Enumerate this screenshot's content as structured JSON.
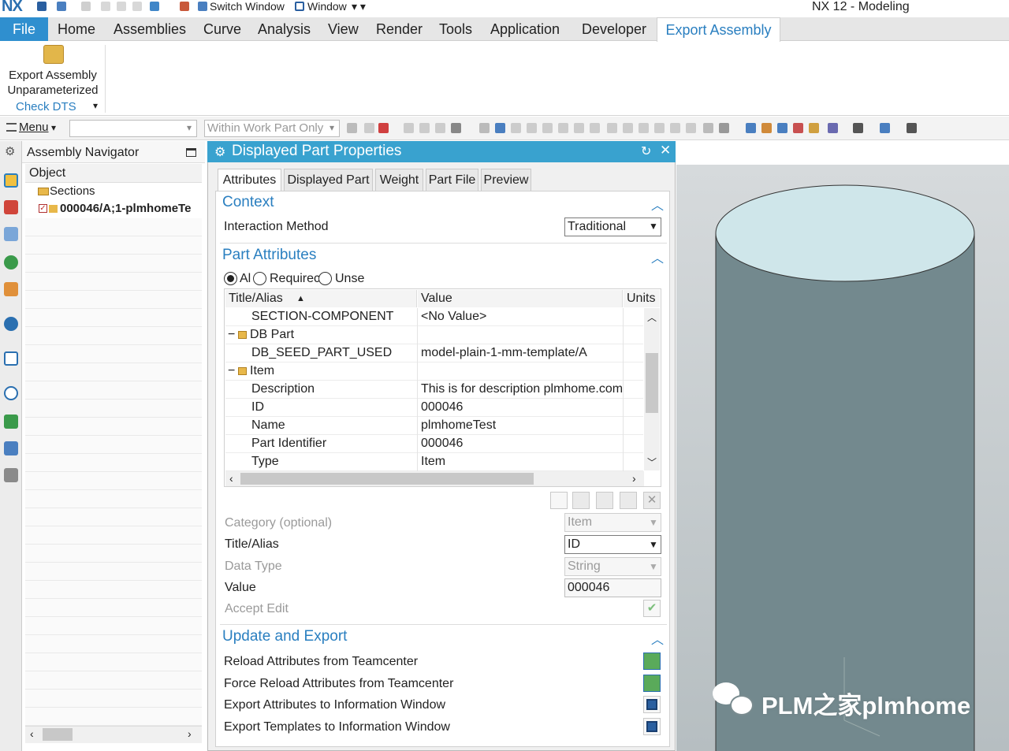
{
  "app": {
    "logo": "NX",
    "title": "NX 12 - Modeling",
    "switch_window": "Switch Window",
    "window_menu": "Window"
  },
  "ribbon": {
    "file": "File",
    "tabs": [
      "Home",
      "Assemblies",
      "Curve",
      "Analysis",
      "View",
      "Render",
      "Tools",
      "Application",
      "Developer"
    ],
    "active_tab": "Export Assembly",
    "export_btn": [
      "Export Assembly",
      "Unparameterized"
    ],
    "check_dts": "Check DTS"
  },
  "cmdbar": {
    "menu": "Menu",
    "filter": "Within Work Part Only",
    "selection_filter": ""
  },
  "navigator": {
    "title": "Assembly Navigator",
    "column": "Object",
    "sections": "Sections",
    "part": "000046/A;1-plmhomeTe"
  },
  "dialog": {
    "title": "Displayed Part Properties",
    "tabs": [
      "Attributes",
      "Displayed Part",
      "Weight",
      "Part File",
      "Preview"
    ],
    "context": {
      "header": "Context",
      "label": "Interaction Method",
      "value": "Traditional"
    },
    "part_attributes": {
      "header": "Part Attributes",
      "radio_all": "Al",
      "radio_required": "Requirec",
      "radio_unset": "Unse"
    },
    "table": {
      "headers": [
        "Title/Alias",
        "Value",
        "Units"
      ],
      "rows": [
        {
          "title": "SECTION-COMPONENT",
          "value": "<No Value>",
          "indent": 2
        },
        {
          "title": "DB Part",
          "value": "",
          "indent": 1
        },
        {
          "title": "DB_SEED_PART_USED",
          "value": "model-plain-1-mm-template/A",
          "indent": 2
        },
        {
          "title": "Item",
          "value": "",
          "indent": 1
        },
        {
          "title": "Description",
          "value": "This is for description plmhome.com",
          "indent": 2
        },
        {
          "title": "ID",
          "value": "000046",
          "indent": 2
        },
        {
          "title": "Name",
          "value": "plmhomeTest",
          "indent": 2
        },
        {
          "title": "Part Identifier",
          "value": "000046",
          "indent": 2
        },
        {
          "title": "Type",
          "value": "Item",
          "indent": 2
        }
      ]
    },
    "form": {
      "category_label": "Category (optional)",
      "category_value": "Item",
      "title_label": "Title/Alias",
      "title_value": "ID",
      "datatype_label": "Data Type",
      "datatype_value": "String",
      "value_label": "Value",
      "value_value": "000046",
      "accept_label": "Accept Edit"
    },
    "update_export": {
      "header": "Update and Export",
      "items": [
        "Reload Attributes from Teamcenter",
        "Force Reload Attributes from Teamcenter",
        "Export Attributes to Information Window",
        "Export Templates to Information Window"
      ]
    }
  },
  "watermark": "PLM之家plmhome",
  "colors": {
    "accent": "#2a7fc0",
    "dialog_header": "#39a2cf",
    "cylinder_side": "#73898e",
    "cylinder_top": "#cfe6ea",
    "viewport": "#cbd0d3"
  }
}
